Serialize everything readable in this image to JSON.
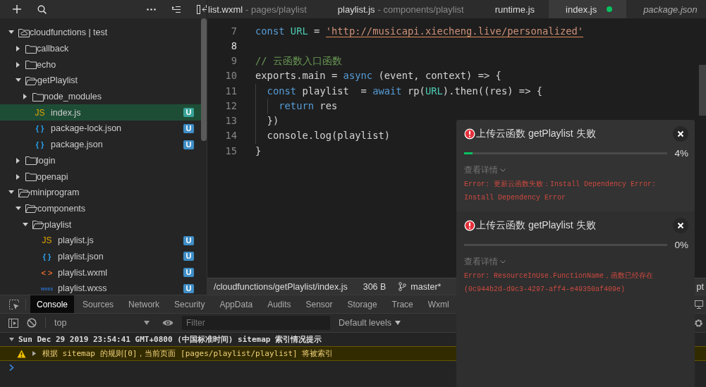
{
  "editor_tabs": [
    {
      "label": "list.wxml",
      "path": "- pages/playlist",
      "selected": false,
      "preview": false,
      "modified": false
    },
    {
      "label": "playlist.js",
      "path": "- components/playlist",
      "selected": false,
      "preview": false,
      "modified": false
    },
    {
      "label": "runtime.js",
      "selected": false,
      "preview": false,
      "modified": false
    },
    {
      "label": "index.js",
      "selected": true,
      "preview": false,
      "modified": true
    },
    {
      "label": "package.json",
      "selected": false,
      "preview": true,
      "modified": false
    }
  ],
  "sidebar": {
    "tree": [
      {
        "label": "cloudfunctions | test",
        "kind": "cloud-folder",
        "expanded": true,
        "selected": false,
        "children": [
          {
            "label": "callback",
            "kind": "folder",
            "expanded": false,
            "selected": false
          },
          {
            "label": "echo",
            "kind": "folder",
            "expanded": false,
            "selected": false
          },
          {
            "label": "getPlaylist",
            "kind": "folder",
            "expanded": true,
            "selected": false,
            "children": [
              {
                "label": "node_modules",
                "kind": "folder",
                "expanded": false,
                "selected": false
              },
              {
                "label": "index.js",
                "kind": "js",
                "icon_label": "JS",
                "badge": "U",
                "selected": true
              },
              {
                "label": "package-lock.json",
                "kind": "json",
                "icon_label": "{ }",
                "badge": "U",
                "selected": false
              },
              {
                "label": "package.json",
                "kind": "json",
                "icon_label": "{ }",
                "badge": "U",
                "selected": false
              }
            ]
          },
          {
            "label": "login",
            "kind": "folder",
            "expanded": false,
            "selected": false
          },
          {
            "label": "openapi",
            "kind": "folder",
            "expanded": false,
            "selected": false
          }
        ]
      },
      {
        "label": "miniprogram",
        "kind": "folder",
        "expanded": true,
        "selected": false,
        "children": [
          {
            "label": "components",
            "kind": "folder",
            "expanded": true,
            "selected": false,
            "children": [
              {
                "label": "playlist",
                "kind": "folder",
                "expanded": true,
                "selected": false,
                "children": [
                  {
                    "label": "playlist.js",
                    "kind": "js",
                    "icon_label": "JS",
                    "badge": "U",
                    "selected": false
                  },
                  {
                    "label": "playlist.json",
                    "kind": "json",
                    "icon_label": "{ }",
                    "badge": "U",
                    "selected": false
                  },
                  {
                    "label": "playlist.wxml",
                    "kind": "wxml",
                    "icon_label": "< >",
                    "badge": "U",
                    "selected": false
                  },
                  {
                    "label": "playlist.wxss",
                    "kind": "wxss",
                    "icon_label": "wxss",
                    "badge": "U",
                    "selected": false
                  }
                ]
              }
            ]
          }
        ]
      }
    ]
  },
  "code": {
    "lines": [
      {
        "number": "7",
        "current": false,
        "tokens": [
          {
            "kind": "keyword",
            "text": "const "
          },
          {
            "kind": "constant",
            "text": "URL"
          },
          {
            "kind": "plain",
            "text": " = "
          },
          {
            "kind": "string",
            "text": "'http://musicapi.xiecheng.live/personalized'"
          }
        ]
      },
      {
        "number": "8",
        "current": true
      },
      {
        "number": "9",
        "current": false,
        "tokens": [
          {
            "kind": "comment",
            "text": "// 云函数入口函数"
          }
        ]
      },
      {
        "number": "10",
        "current": false,
        "tokens": [
          {
            "kind": "plain",
            "text": "exports.main = "
          },
          {
            "kind": "keyword",
            "text": "async"
          },
          {
            "kind": "plain",
            "text": " (event, context) => {"
          }
        ],
        "children": [
          {
            "number": "11",
            "current": false,
            "tokens": [
              {
                "kind": "keyword",
                "text": "const"
              },
              {
                "kind": "plain",
                "text": " playlist  = "
              },
              {
                "kind": "keyword",
                "text": "await"
              },
              {
                "kind": "plain",
                "text": " rp("
              },
              {
                "kind": "constant",
                "text": "URL"
              },
              {
                "kind": "plain",
                "text": ").then((res) => {"
              }
            ],
            "children": [
              {
                "number": "12",
                "current": false,
                "tokens": [
                  {
                    "kind": "keyword",
                    "text": "return"
                  },
                  {
                    "kind": "plain",
                    "text": " res"
                  }
                ]
              }
            ]
          },
          {
            "number": "13",
            "current": false,
            "tokens": [
              {
                "kind": "plain",
                "text": "})"
              }
            ]
          },
          {
            "number": "14",
            "current": false,
            "tokens": [
              {
                "kind": "plain",
                "text": "console.log(playlist)"
              }
            ]
          }
        ]
      },
      {
        "number": "15",
        "current": false,
        "tokens": [
          {
            "kind": "plain",
            "text": "}"
          }
        ]
      }
    ]
  },
  "status_bar": {
    "path": "/cloudfunctions/getPlaylist/index.js",
    "size": "306 B",
    "branch": "master*",
    "language": "pt"
  },
  "devtools": {
    "tabs": [
      {
        "label": "Console",
        "selected": true
      },
      {
        "label": "Sources",
        "selected": false
      },
      {
        "label": "Network",
        "selected": false
      },
      {
        "label": "Security",
        "selected": false
      },
      {
        "label": "AppData",
        "selected": false
      },
      {
        "label": "Audits",
        "selected": false
      },
      {
        "label": "Sensor",
        "selected": false
      },
      {
        "label": "Storage",
        "selected": false
      },
      {
        "label": "Trace",
        "selected": false
      },
      {
        "label": "Wxml",
        "selected": false
      }
    ],
    "context": "top",
    "filter": {
      "placeholder": "Filter"
    },
    "levels": "Default levels",
    "messages": [
      {
        "kind": "group",
        "expanded": true,
        "text": "Sun Dec 29 2019 23:54:41 GMT+0800 (中国标准时间) sitemap 索引情况提示"
      },
      {
        "kind": "warning",
        "expanded": false,
        "text": "根据 sitemap 的规则[0]，当前页面 [pages/playlist/playlist] 将被索引"
      }
    ]
  },
  "notifications": [
    {
      "title": "上传云函数 getPlaylist 失败",
      "level": 0.04,
      "percent": "4%",
      "details": "查看详情",
      "error": "Error: 更新云函数失败：Install Dependency Error: Install Dependency Error"
    },
    {
      "title": "上传云函数 getPlaylist 失败",
      "level": 0,
      "percent": "0%",
      "details": "查看详情",
      "error": "Error: ResourceInUse.FunctionName，函数已经存在(0c944b2d-d9c3-4297-aff4-e49350af409e)"
    }
  ]
}
